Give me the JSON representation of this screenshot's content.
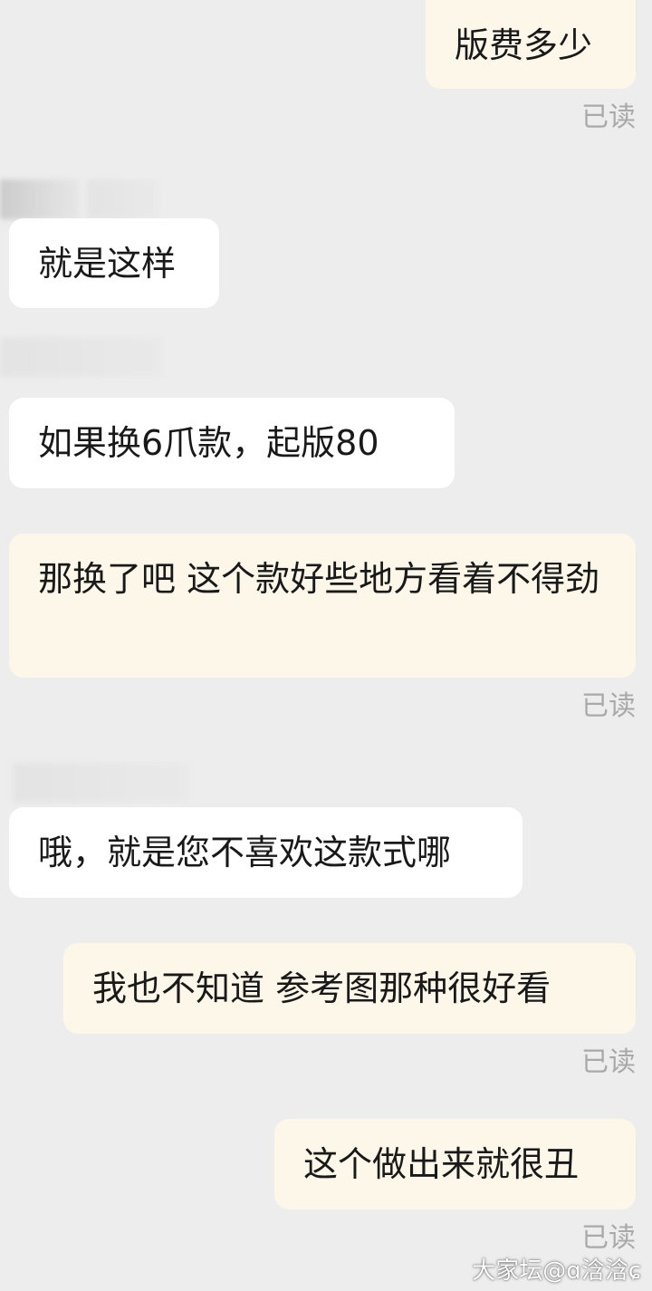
{
  "chat": {
    "messages": [
      {
        "id": "m1",
        "side": "out",
        "text": "版费多少",
        "status": "已读"
      },
      {
        "id": "m2",
        "side": "in",
        "text": "就是这样"
      },
      {
        "id": "m3",
        "side": "in",
        "text": "如果换6爪款，起版80"
      },
      {
        "id": "m4",
        "side": "out",
        "text": "那换了吧  这个款好些地方看着不得劲",
        "status": "已读"
      },
      {
        "id": "m5",
        "side": "in",
        "text": "哦，就是您不喜欢这款式哪"
      },
      {
        "id": "m6",
        "side": "out",
        "text": "我也不知道  参考图那种很好看",
        "status": "已读"
      },
      {
        "id": "m7",
        "side": "out",
        "text": "这个做出来就很丑",
        "status": "已读"
      }
    ]
  },
  "watermark": {
    "text": "大家坛@ɑ浛浛ɕ"
  },
  "colors": {
    "background": "#ededed",
    "incoming_bubble": "#ffffff",
    "outgoing_bubble": "#fdf7e9",
    "read_receipt": "#a9a9a9",
    "text": "#191919"
  }
}
